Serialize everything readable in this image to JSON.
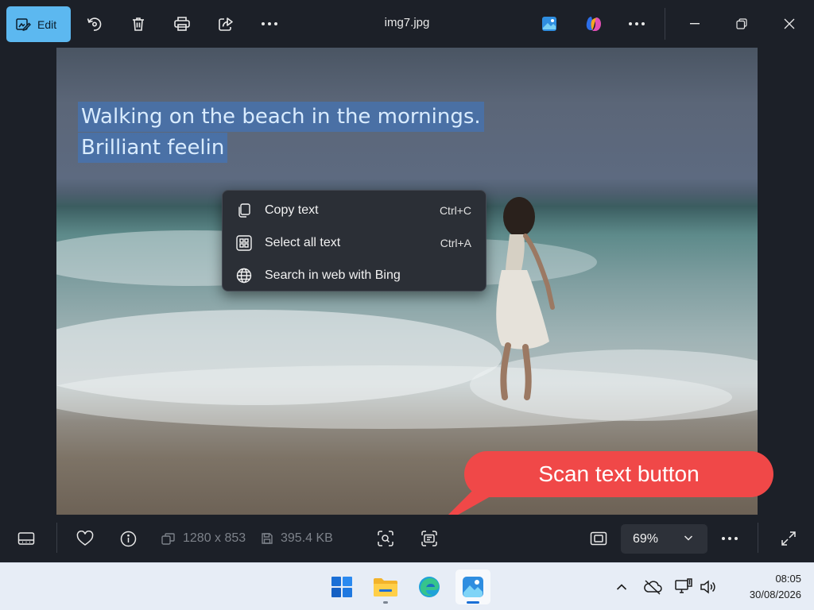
{
  "toolbar": {
    "edit_label": "Edit",
    "title": "img7.jpg",
    "icons": [
      "edit-icon",
      "rotate-icon",
      "delete-icon",
      "print-icon",
      "share-icon",
      "more-icon",
      "designer-icon",
      "copilot-icon",
      "more-icon",
      "minimize-icon",
      "restore-icon",
      "close-icon"
    ]
  },
  "image": {
    "selected_text": [
      "Walking on the beach in the mornings.",
      "Brilliant feelin"
    ]
  },
  "context_menu": {
    "items": [
      {
        "label": "Copy text",
        "shortcut": "Ctrl+C",
        "icon": "copy-icon"
      },
      {
        "label": "Select all text",
        "shortcut": "Ctrl+A",
        "icon": "select-all-icon"
      },
      {
        "label": "Search in web with Bing",
        "shortcut": "",
        "icon": "globe-icon"
      }
    ]
  },
  "annotation": {
    "callout_text": "Scan text button",
    "color": "#f04848"
  },
  "statusbar": {
    "dimensions": "1280 x 853",
    "file_size": "395.4 KB",
    "zoom": "69%",
    "icons": [
      "filmstrip-icon",
      "favorite-icon",
      "info-icon",
      "dimensions-icon",
      "file-size-icon",
      "visual-search-icon",
      "scan-text-icon",
      "fit-window-icon",
      "zoom-dropdown-icon",
      "more-icon",
      "full-screen-icon"
    ]
  },
  "taskbar": {
    "apps": [
      "start",
      "file-explorer",
      "edge",
      "photos"
    ],
    "active_app": "photos",
    "tray_icons": [
      "chevron-up-icon",
      "onedrive-offline-icon",
      "network-icon",
      "volume-icon"
    ],
    "time": "08:05",
    "date": "30/08/2026"
  },
  "colors": {
    "accent": "#5cb8f0",
    "background": "#1c2028",
    "taskbar": "#e7edf6",
    "callout": "#f04848"
  }
}
